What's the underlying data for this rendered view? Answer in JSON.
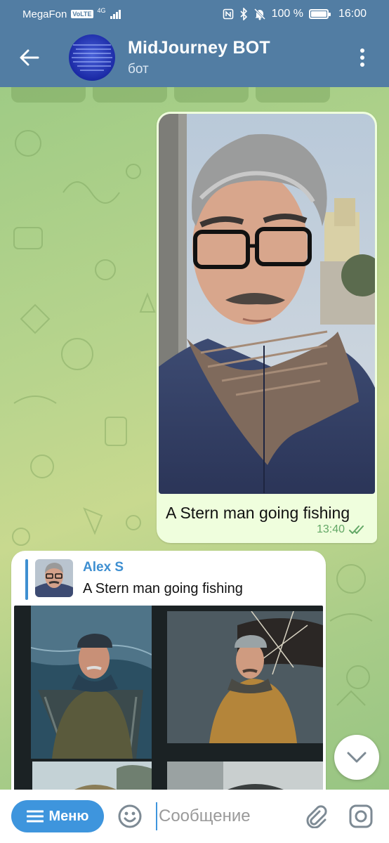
{
  "status_bar": {
    "carrier": "MegaFon",
    "volte": "VoLTE",
    "network": "4G",
    "battery_text": "100 %",
    "battery_level": 1.0,
    "time": "16:00"
  },
  "header": {
    "title": "MidJourney BOT",
    "subtitle": "бот"
  },
  "outgoing_message": {
    "caption": "A Stern man going fishing",
    "time": "13:40",
    "status": "read"
  },
  "incoming_message": {
    "reply_name": "Alex S",
    "reply_text": "A Stern man going fishing"
  },
  "input": {
    "menu_label": "Меню",
    "placeholder": "Сообщение"
  },
  "colors": {
    "header": "#527da3",
    "accent": "#3e95dd",
    "outgoing_bubble": "#effedd",
    "check_green": "#63a866"
  }
}
